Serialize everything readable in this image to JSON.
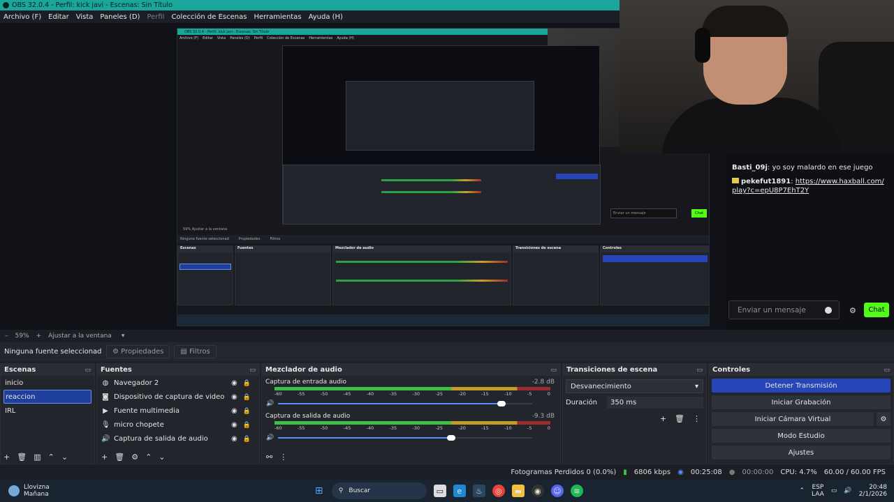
{
  "window": {
    "title": "OBS 32.0.4 - Perfil: kick javi - Escenas: Sin Título"
  },
  "menu": {
    "items": [
      "Archivo (F)",
      "Editar",
      "Vista",
      "Paneles (D)",
      "Perfil",
      "Colección de Escenas",
      "Herramientas",
      "Ayuda (H)"
    ]
  },
  "preview": {
    "nested_title": "OBS 32.0.4 - Perfil: kick javi - Escenas: Sin Título",
    "nested_menu": [
      "Archivo (F)",
      "Editar",
      "Vista",
      "Paneles (D)",
      "Perfil",
      "Colección de Escenas",
      "Herramientas",
      "Ayuda (H)"
    ],
    "nested_chat_placeholder": "Enviar un mensaje",
    "nested_chat_btn": "Chat",
    "nested_zoom": "59%   Ajustar a la ventana",
    "nested_no_source": "Ninguna fuente seleccionad",
    "nested_props": "Propiedades",
    "nested_filters": "Filtros",
    "nested_docks": [
      "Escenas",
      "Fuentes",
      "Mezclador de audio",
      "Transiciones de escena",
      "Controles"
    ]
  },
  "chat": {
    "messages": [
      {
        "user": "Basti_09j",
        "user_color": "#e6c84a",
        "text": "yo soy malardo en ese juego"
      },
      {
        "user": "pekefut1891",
        "user_color": "#e6c84a",
        "text": "https://www.haxball.com/play?c=epU8P7EhT2Y"
      }
    ],
    "input_placeholder": "Enviar un mensaje",
    "send_label": "Chat"
  },
  "zoom": {
    "value": "59%",
    "fit": "Ajustar a la ventana"
  },
  "source_bar": {
    "no_source": "Ninguna fuente seleccionad",
    "properties": "Propiedades",
    "filters": "Filtros"
  },
  "scenes": {
    "title": "Escenas",
    "items": [
      "inicio",
      "reaccion",
      "IRL"
    ],
    "selected": "reaccion"
  },
  "sources": {
    "title": "Fuentes",
    "items": [
      {
        "name": "Navegador 2",
        "icon": "globe-icon"
      },
      {
        "name": "Dispositivo de captura de video",
        "icon": "camera-icon"
      },
      {
        "name": "Fuente multimedia",
        "icon": "play-icon"
      },
      {
        "name": "micro chopete",
        "icon": "mic-icon"
      },
      {
        "name": "Captura de salida de audio",
        "icon": "speaker-icon"
      }
    ]
  },
  "mixer": {
    "title": "Mezclador de audio",
    "channels": [
      {
        "name": "Captura de entrada audio",
        "db": "-2.8 dB",
        "level": 0.92,
        "volume": 0.88
      },
      {
        "name": "Captura de salida de audio",
        "db": "-9.3 dB",
        "level": 0.8,
        "volume": 0.68
      }
    ],
    "ticks": [
      "-60",
      "-55",
      "-50",
      "-45",
      "-40",
      "-35",
      "-30",
      "-25",
      "-20",
      "-15",
      "-10",
      "-5",
      "0"
    ]
  },
  "transitions": {
    "title": "Transiciones de escena",
    "selected": "Desvanecimiento",
    "duration_label": "Duración",
    "duration_value": "350 ms"
  },
  "controls": {
    "title": "Controles",
    "buttons": [
      "Detener Transmisión",
      "Iniciar Grabación",
      "Iniciar Cámara Virtual",
      "Modo Estudio",
      "Ajustes"
    ]
  },
  "status": {
    "dropped": "Fotogramas Perdidos 0 (0.0%)",
    "kbps": "6806 kbps",
    "stream_time": "00:25:08",
    "rec_time": "00:00:00",
    "cpu": "CPU: 4.7%",
    "fps": "60.00 / 60.00 FPS"
  },
  "taskbar": {
    "weather_1": "Llovizna",
    "weather_2": "Mañana",
    "search": "Buscar",
    "lang_1": "ESP",
    "lang_2": "LAA",
    "time": "20:48",
    "date": "2/1/2026"
  }
}
